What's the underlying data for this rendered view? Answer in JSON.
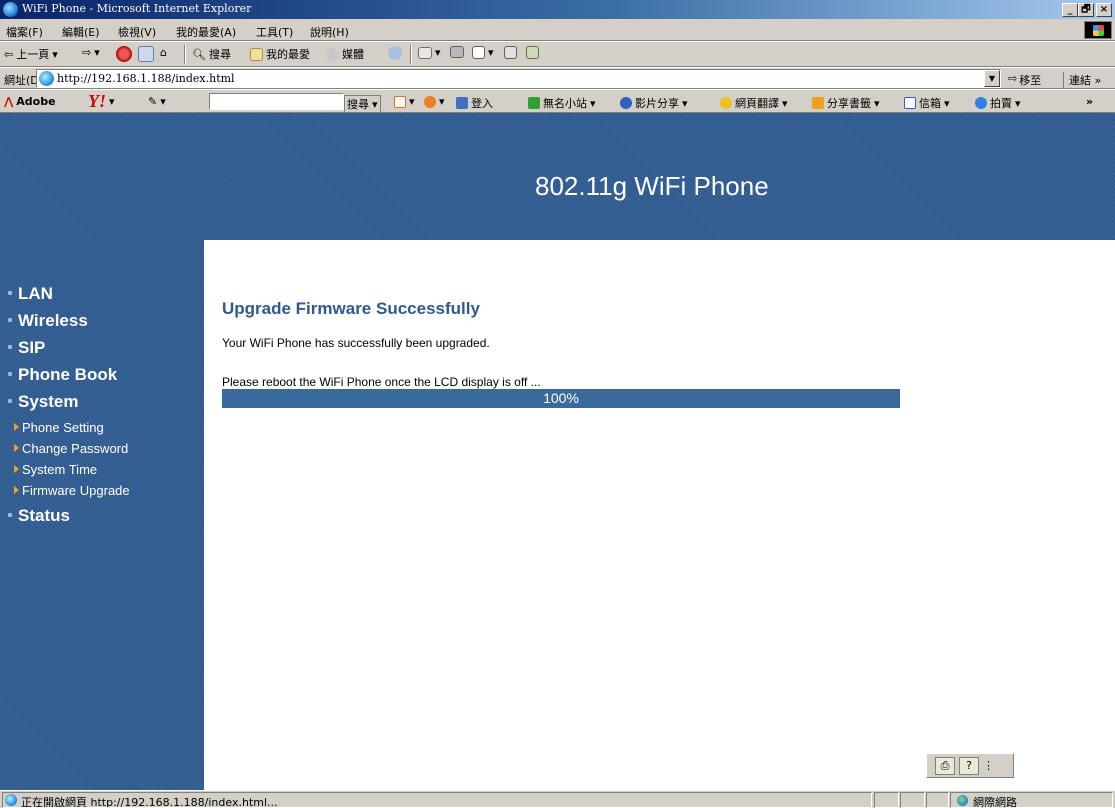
{
  "window": {
    "title": "WiFi Phone - Microsoft Internet Explorer",
    "minimize": "_",
    "maximize": "🗗",
    "close": "×"
  },
  "menu": [
    "檔案(F)",
    "編輯(E)",
    "檢視(V)",
    "我的最愛(A)",
    "工具(T)",
    "說明(H)"
  ],
  "toolbar": {
    "back": "上一頁",
    "search": "搜尋",
    "favorites": "我的最愛",
    "media": "媒體"
  },
  "address": {
    "label": "網址(D)",
    "url": "http://192.168.1.188/index.html",
    "go": "移至",
    "links": "連結 »"
  },
  "yahoo_bar": {
    "adobe": "Adobe",
    "yahoo": "Y!",
    "search_btn": "搜尋",
    "login": "登入",
    "items": [
      "無名小站",
      "影片分享",
      "網頁翻譯",
      "分享書籤",
      "信箱",
      "拍賣"
    ]
  },
  "page": {
    "banner_title": "802.11g WiFi Phone",
    "nav": {
      "lan": "LAN",
      "wireless": "Wireless",
      "sip": "SIP",
      "phonebook": "Phone Book",
      "system": "System",
      "system_sub": [
        "Phone Setting",
        "Change Password",
        "System Time",
        "Firmware Upgrade"
      ],
      "status": "Status"
    },
    "heading": "Upgrade Firmware Successfully",
    "message": "Your WiFi Phone has successfully been upgraded.",
    "reboot_note": "Please reboot the WiFi Phone once the LCD display is off ...",
    "progress": {
      "value": 1.0,
      "label": "100%"
    }
  },
  "statusbar": {
    "text": "正在開啟網頁 http://192.168.1.188/index.html...",
    "zone": "網際網路"
  },
  "colors": {
    "banner": "#2f5a8f",
    "heading": "#2f5a8f",
    "progress_fill": "#3a6a9a",
    "nav_bullet": "#f0a020"
  }
}
